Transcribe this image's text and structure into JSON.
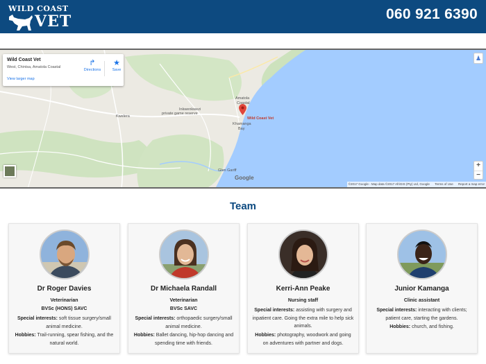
{
  "header": {
    "logo_top": "WILD COAST",
    "logo_big": "VET",
    "phone": "060 921 6390"
  },
  "map": {
    "place_name": "Wild Coast Vet",
    "address": "West, Chintsa, Amatola Coastal",
    "view_larger": "View larger map",
    "directions": "Directions",
    "save": "Save",
    "pin_label": "Wild Coast Vet",
    "labels": {
      "kwelera": "Kwelera",
      "inkwenkwezi": "Inkwenkwezi",
      "reserve": "private game reserve",
      "amatola": "Amatola",
      "coastal": "Coastal",
      "khamanga": "Khamanga",
      "bay": "Bay",
      "glen": "Glen Gariff"
    },
    "google": "Google",
    "attribution": "©2017 Google - Map data ©2017 AfriGIS (Pty) Ltd, Google",
    "terms": "Terms of Use",
    "report": "Report a map error",
    "zoom_in": "+",
    "zoom_out": "−"
  },
  "team": {
    "heading": "Team",
    "label_special": "Special interests:",
    "label_hobbies": "Hobbies:",
    "members": [
      {
        "name": "Dr Roger Davies",
        "role": "Veterinarian",
        "qual": "BVSc (HONS) SAVC",
        "interests": "soft tissue surgery/small animal medicine.",
        "hobbies": "Trail-running, spear fishing, and the natural world."
      },
      {
        "name": "Dr Michaela Randall",
        "role": "Veterinarian",
        "qual": "BVSc SAVC",
        "interests": "orthopaedic surgery/small animal medicine.",
        "hobbies": "Ballet dancing, hip-hop dancing and spending time with friends."
      },
      {
        "name": "Kerri-Ann Peake",
        "role": "Nursing staff",
        "interests": "assisting with surgery and inpatient care. Going the extra mile to help sick animals.",
        "hobbies": "photography, woodwork and going on adventures with partner and dogs."
      },
      {
        "name": "Junior Kamanga",
        "role": "Clinic assistant",
        "interests": "interacting with clients; patient care, starting the gardens.",
        "hobbies": "church, and fishing."
      }
    ]
  }
}
